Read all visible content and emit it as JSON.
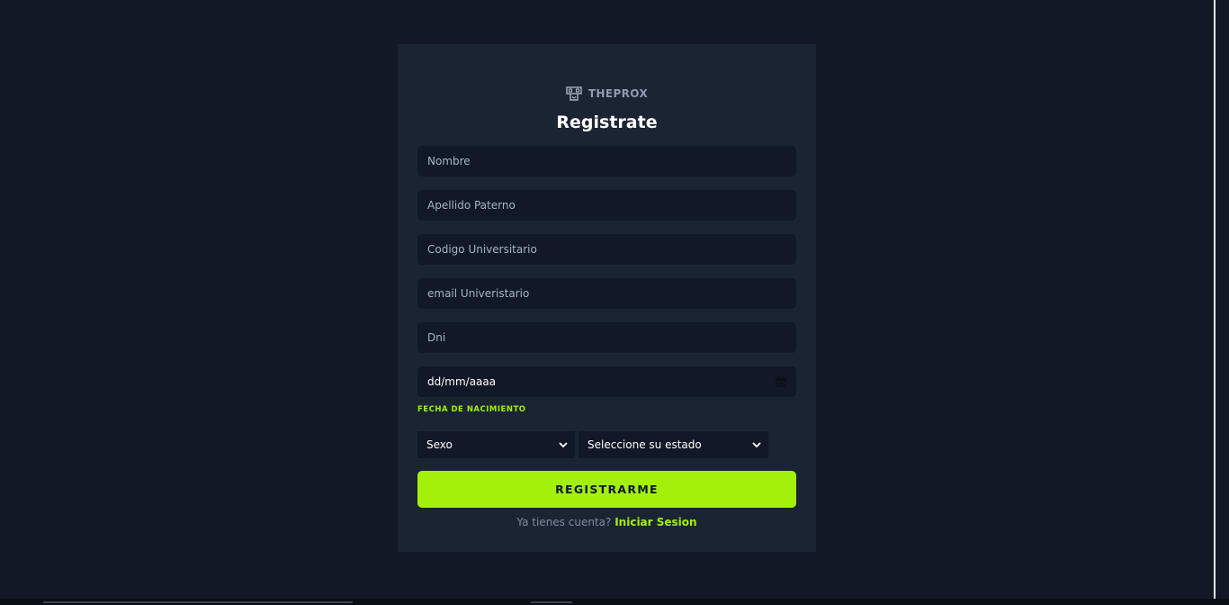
{
  "brand": {
    "name": "THEPROX",
    "icon": "theprox-logo-icon"
  },
  "form": {
    "title": "Registrate",
    "fields": {
      "nombre_placeholder": "Nombre",
      "apellido_placeholder": "Apellido Paterno",
      "codigo_placeholder": "Codigo Universitario",
      "email_placeholder": "email Univeristario",
      "dni_placeholder": "Dni",
      "fecha_value": "dd/mm/aaaa",
      "fecha_label": "FECHA DE NACIMIENTO",
      "sexo_selected": "Sexo",
      "estado_selected": "Seleccione su estado"
    },
    "submit_label": "REGISTRARME",
    "footer_text": "Ya tienes cuenta?",
    "footer_link": "Iniciar Sesion"
  },
  "colors": {
    "page_bg": "#121826",
    "card_bg": "#1b2433",
    "input_bg": "#111827",
    "accent": "#a3f00b"
  }
}
